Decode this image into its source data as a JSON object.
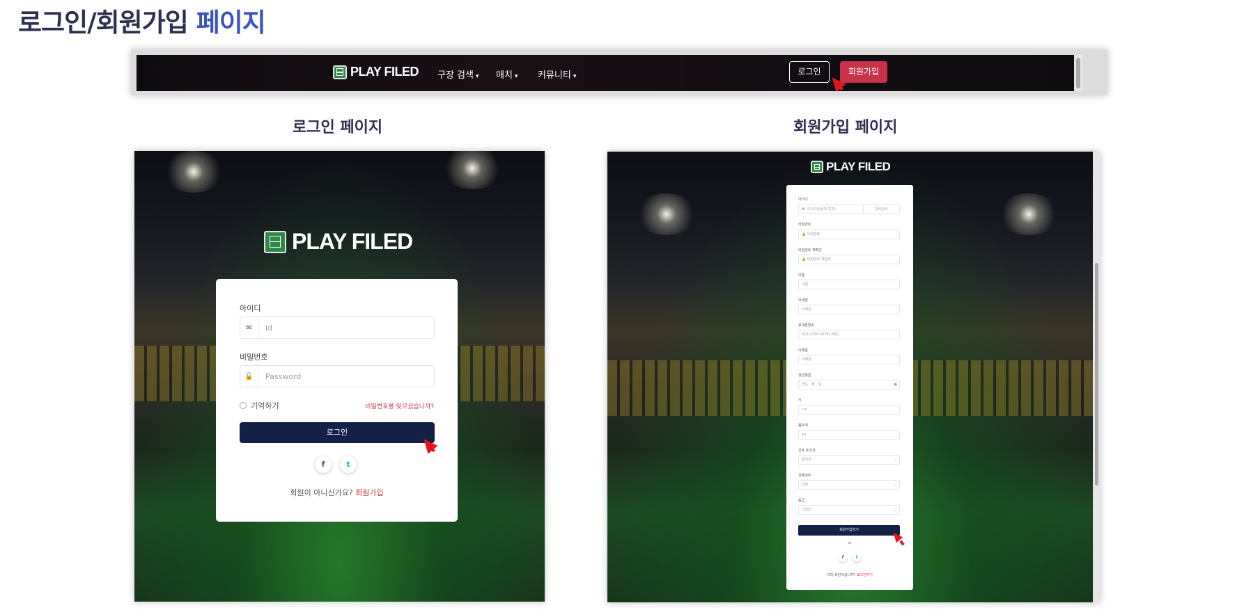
{
  "slide": {
    "title_main": "로그인/회원가입",
    "title_accent": "페이지"
  },
  "navbar": {
    "brand": "PLAY FILED",
    "menu": [
      "구장 검색",
      "매치",
      "커뮤니티"
    ],
    "login_label": "로그인",
    "signup_label": "회원가입"
  },
  "sections": {
    "login_title": "로그인 페이지",
    "signup_title": "회원가입 페이지"
  },
  "login_page": {
    "brand": "PLAY FILED",
    "id_label": "아이디",
    "id_placeholder": "id",
    "password_label": "비밀번호",
    "password_placeholder": "Password",
    "remember_label": "기억하기",
    "forgot_link": "비밀번호를 잊으셨습니까?",
    "login_button": "로그인",
    "facebook_icon": "f",
    "twitter_icon": "t",
    "footer_text": "회원이 아니신가요?",
    "footer_link": "회원가입"
  },
  "signup_page": {
    "brand": "PLAY FILED",
    "fields": {
      "id": {
        "label": "아이디",
        "placeholder": "아이디(6글자 초과)",
        "action": "중복검사"
      },
      "password": {
        "label": "비밀번호",
        "placeholder": "비밀번호"
      },
      "password_confirm": {
        "label": "비밀번호 재확인",
        "placeholder": "비밀번호 재입력"
      },
      "name": {
        "label": "이름",
        "placeholder": "이름"
      },
      "nickname": {
        "label": "닉네임",
        "placeholder": "닉네임"
      },
      "phone": {
        "label": "휴대폰번호",
        "placeholder": "010-1234-5678(-제외)"
      },
      "email": {
        "label": "이메일",
        "placeholder": "이메일"
      },
      "birth": {
        "label": "생년월일",
        "placeholder": "연도 - 월 - 일"
      },
      "height": {
        "label": "키",
        "placeholder": "cm"
      },
      "weight": {
        "label": "몸무게",
        "placeholder": "kg"
      },
      "position": {
        "label": "선호 포지션",
        "value": "골키퍼"
      },
      "experience": {
        "label": "선출여부",
        "value": "선출"
      },
      "grade": {
        "label": "등급",
        "value": "스타터"
      }
    },
    "submit_button": "회원가입하기",
    "or_text": "or",
    "footer_text": "이미 회원이십니까?",
    "footer_link": "로그인하기"
  },
  "colors": {
    "accent_blue": "#3b52c4",
    "brand_red": "#c9334a",
    "navy_button": "#142046"
  }
}
